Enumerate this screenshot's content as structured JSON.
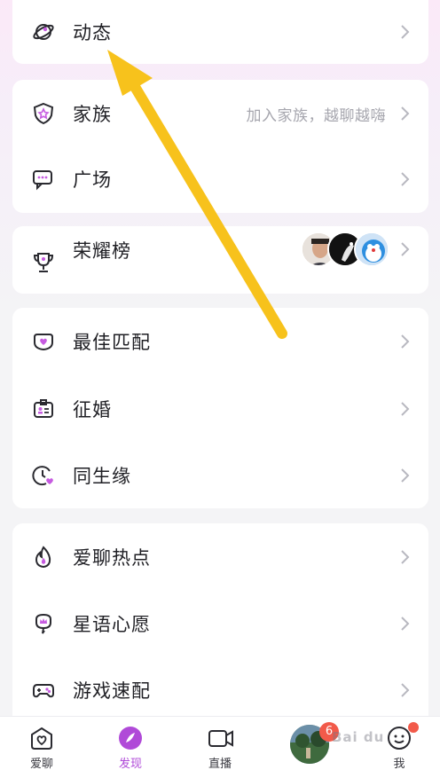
{
  "menu": {
    "moments": {
      "label": "动态",
      "icon": "planet-icon"
    },
    "family": {
      "label": "家族",
      "hint": "加入家族，越聊越嗨",
      "icon": "shield-star-icon"
    },
    "square": {
      "label": "广场",
      "icon": "chat-bubbles-icon"
    },
    "ranking": {
      "label": "荣耀榜",
      "icon": "trophy-icon"
    },
    "best_match": {
      "label": "最佳匹配",
      "icon": "heart-mask-icon"
    },
    "marriage": {
      "label": "征婚",
      "icon": "id-badge-icon"
    },
    "same_birth": {
      "label": "同生缘",
      "icon": "clock-heart-icon"
    },
    "hot_topics": {
      "label": "爱聊热点",
      "icon": "flame-icon"
    },
    "wishes": {
      "label": "星语心愿",
      "icon": "crown-lamp-icon"
    },
    "game_match": {
      "label": "游戏速配",
      "icon": "gamepad-icon"
    }
  },
  "tabbar": {
    "chat": {
      "label": "爱聊",
      "icon": "heart-home-icon"
    },
    "discover": {
      "label": "发现",
      "icon": "compass-icon"
    },
    "live": {
      "label": "直播",
      "icon": "video-camera-icon"
    },
    "avatar_badge": "6",
    "me": {
      "label": "我",
      "icon": "smiley-icon"
    }
  },
  "watermark": "Bai du",
  "colors": {
    "accent": "#b04ad8",
    "arrow": "#f7c21c",
    "badge": "#f25a4a"
  }
}
